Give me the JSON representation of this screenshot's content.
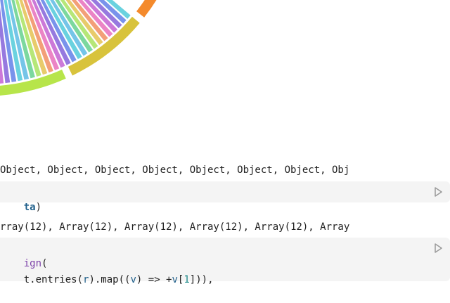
{
  "chart_data": {
    "type": "chord",
    "arc_colors": [
      "#f48a2c",
      "#d8c33c",
      "#b7e54a",
      "#8fd8c6",
      "#6a6fd0",
      "#e96cb8",
      "#9bd35a"
    ],
    "ribbon_colors": [
      "#49c8d8",
      "#5b7be6",
      "#7f5bd8",
      "#c15cd0",
      "#e769b8",
      "#f08a5a",
      "#e3c04a",
      "#a6e25a",
      "#5fd08a",
      "#57b8e3"
    ]
  },
  "outputs": {
    "objects_line": "Object, Object, Object, Object, Object, Object, Object, Obj",
    "arrays_line": "rray(12), Array(12), Array(12), Array(12), Array(12), Array"
  },
  "cell1": {
    "code_token": "ta",
    "code_close": ")"
  },
  "cell2": {
    "line1_fn": "ign",
    "line1_paren": "(",
    "line2_a": "t.entries(",
    "line2_r": "r",
    "line2_b": ").map((",
    "line2_v": "v",
    "line2_c": ") => +",
    "line2_v2": "v",
    "line2_d": "[",
    "line2_num": "1",
    "line2_e": "])),"
  },
  "icons": {
    "run": "run-icon"
  }
}
